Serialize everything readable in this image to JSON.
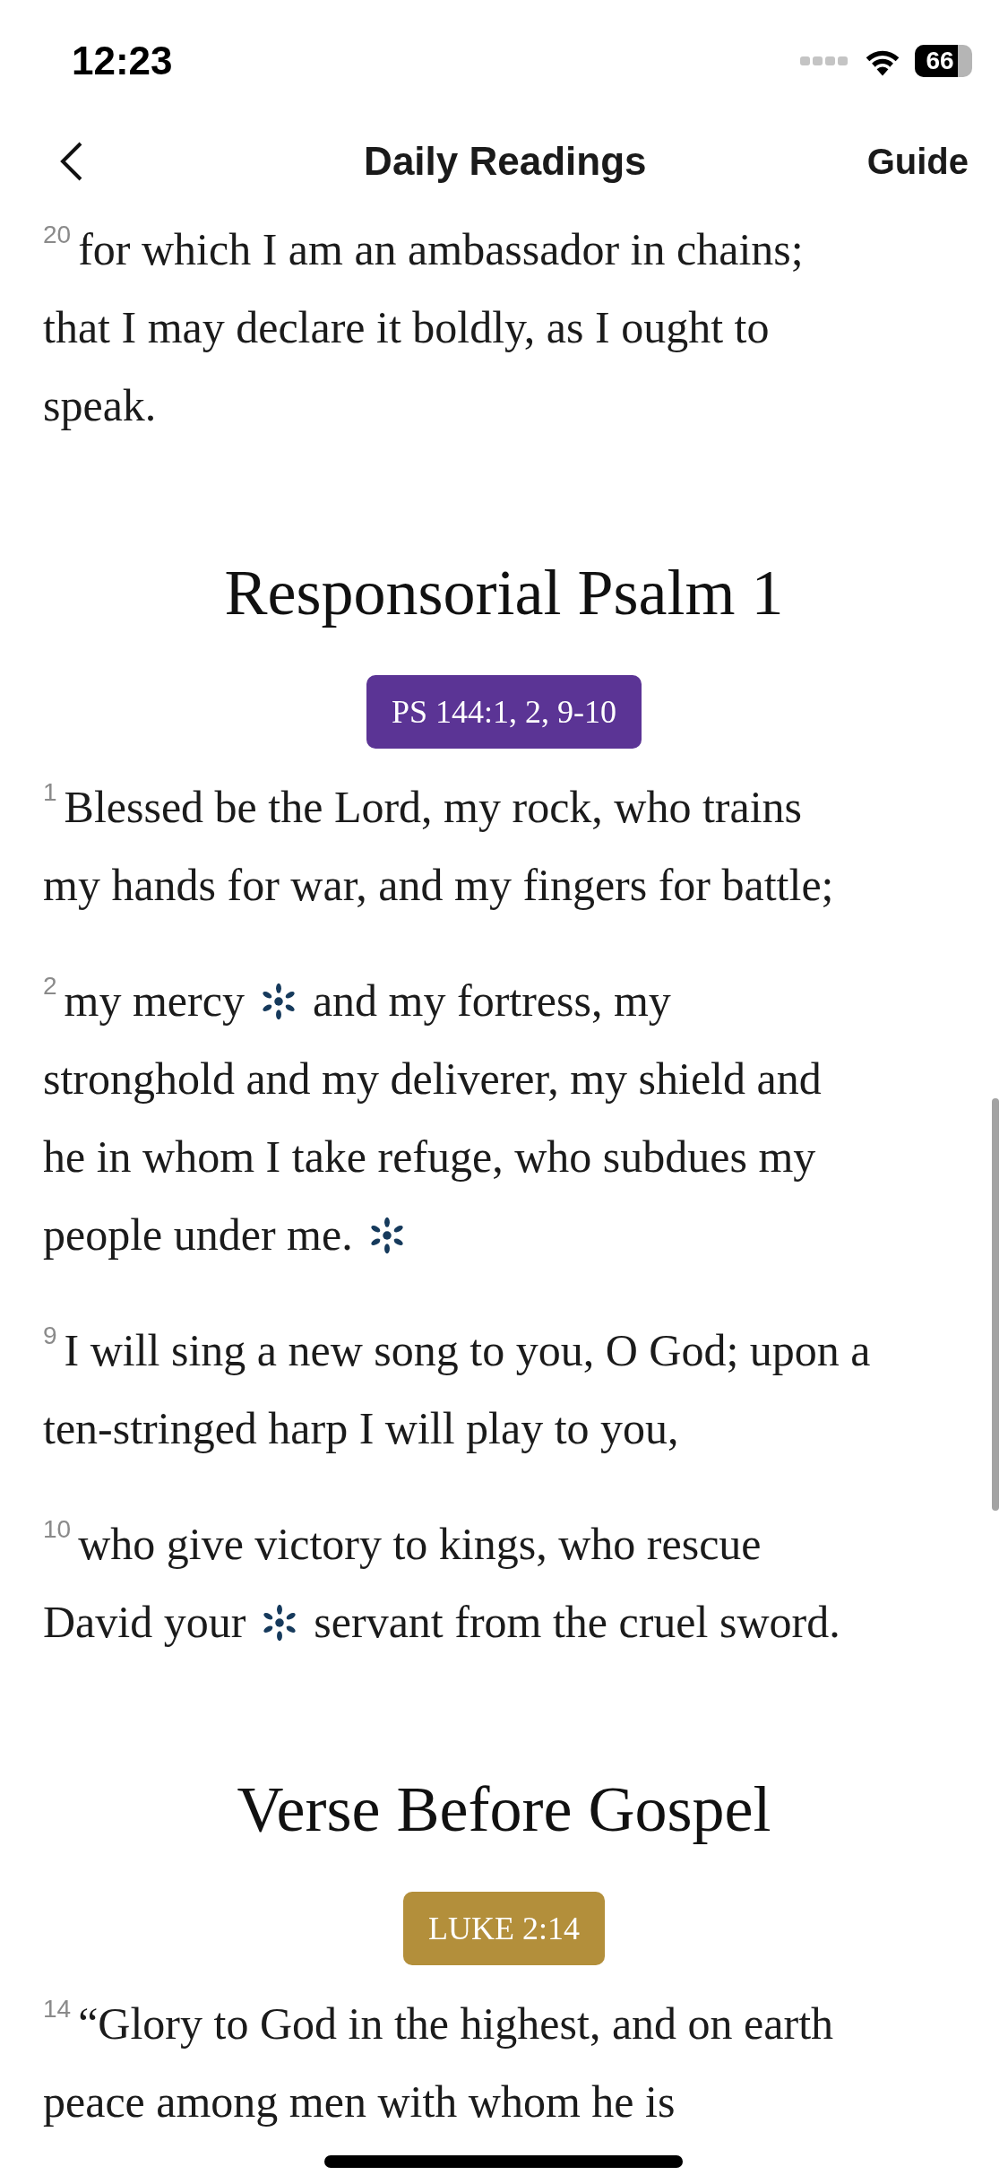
{
  "status_bar": {
    "time": "12:23",
    "battery": "66"
  },
  "nav": {
    "title": "Daily Readings",
    "action": "Guide"
  },
  "sections": [
    {
      "kind": "continuation",
      "verses": [
        {
          "number": "20",
          "lines": [
            [
              {
                "kind": "text",
                "text": "for which I am an ambassador in chains;"
              }
            ],
            [
              {
                "kind": "text",
                "text": "that I may declare it boldly, as I ought to"
              }
            ],
            [
              {
                "kind": "text",
                "text": "speak."
              }
            ]
          ]
        }
      ]
    },
    {
      "kind": "reading",
      "title": "Responsorial Psalm 1",
      "reference": "PS 144:1, 2, 9-10",
      "color": "#5b3495",
      "verses": [
        {
          "number": "1",
          "lines": [
            [
              {
                "kind": "text",
                "text": "Blessed be the Lord, my rock, who trains"
              }
            ],
            [
              {
                "kind": "text",
                "text": "my hands for war, and my fingers for battle;"
              }
            ]
          ]
        },
        {
          "number": "2",
          "lines": [
            [
              {
                "kind": "text",
                "text": "my mercy"
              },
              {
                "kind": "mark"
              },
              {
                "kind": "text",
                "text": "and my fortress, my"
              }
            ],
            [
              {
                "kind": "text",
                "text": "stronghold and my deliverer, my shield and"
              }
            ],
            [
              {
                "kind": "text",
                "text": "he in whom I take refuge, who subdues my"
              }
            ],
            [
              {
                "kind": "text",
                "text": "people under me."
              },
              {
                "kind": "mark"
              }
            ]
          ]
        },
        {
          "number": "9",
          "lines": [
            [
              {
                "kind": "text",
                "text": "I will sing a new song to you, O God; upon a"
              }
            ],
            [
              {
                "kind": "text",
                "text": "ten-stringed harp I will play to you,"
              }
            ]
          ]
        },
        {
          "number": "10",
          "lines": [
            [
              {
                "kind": "text",
                "text": "who give victory to kings, who rescue"
              }
            ],
            [
              {
                "kind": "text",
                "text": "David your"
              },
              {
                "kind": "mark"
              },
              {
                "kind": "text",
                "text": "servant from the cruel sword."
              }
            ]
          ]
        }
      ]
    },
    {
      "kind": "reading",
      "title": "Verse Before Gospel",
      "reference": "LUKE 2:14",
      "color": "#b38f3b",
      "verses": [
        {
          "number": "14",
          "lines": [
            [
              {
                "kind": "text",
                "text": "“Glory to God in the highest, and on earth"
              }
            ],
            [
              {
                "kind": "text",
                "text": "peace among men with whom he is"
              }
            ]
          ]
        }
      ]
    }
  ]
}
